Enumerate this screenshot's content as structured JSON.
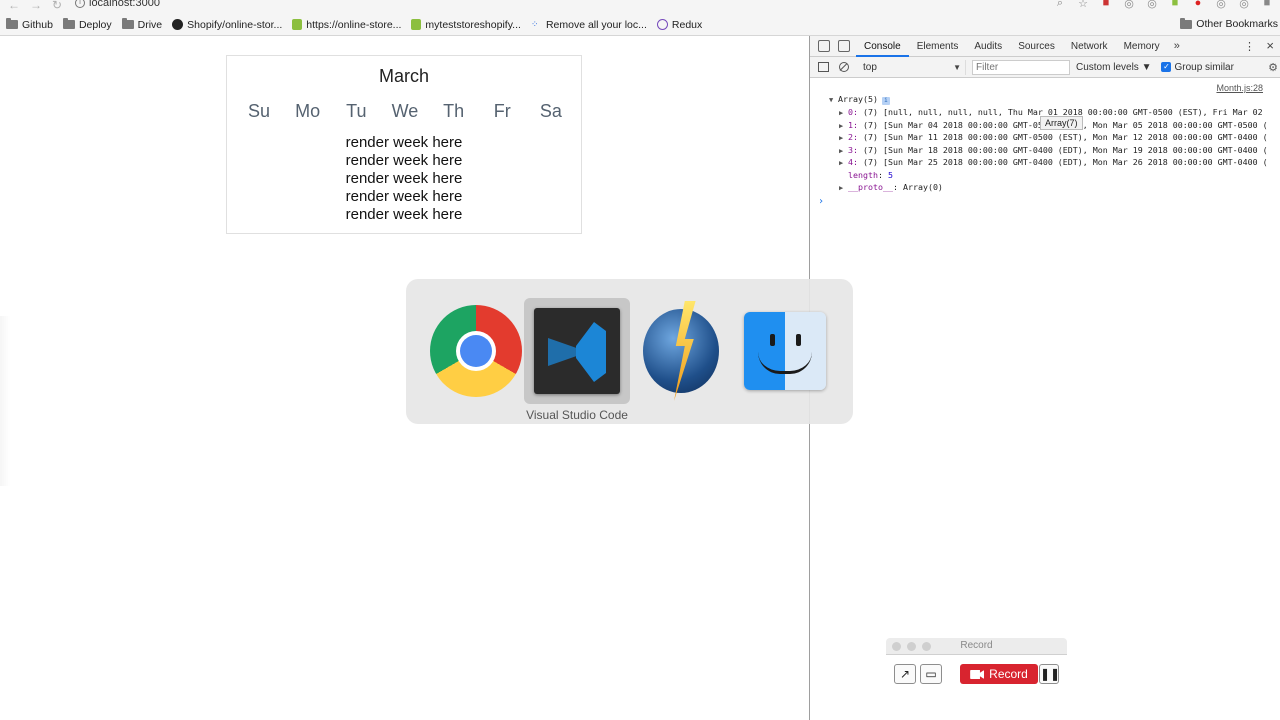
{
  "browser": {
    "url": "localhost:3000",
    "bookmarks": [
      {
        "label": "Github",
        "icon": "folder-icon"
      },
      {
        "label": "Deploy",
        "icon": "folder-icon"
      },
      {
        "label": "Drive",
        "icon": "folder-icon"
      },
      {
        "label": "Shopify/online-stor...",
        "icon": "github-icon"
      },
      {
        "label": "https://online-store...",
        "icon": "shopify-icon"
      },
      {
        "label": "myteststoreshopify...",
        "icon": "shopify-icon"
      },
      {
        "label": "Remove all your loc...",
        "icon": "dots-icon"
      },
      {
        "label": "Redux",
        "icon": "redux-icon"
      }
    ],
    "other_bookmarks": "Other Bookmarks"
  },
  "calendar": {
    "month": "March",
    "days": [
      "Su",
      "Mo",
      "Tu",
      "We",
      "Th",
      "Fr",
      "Sa"
    ],
    "weeks": [
      "render week here",
      "render week here",
      "render week here",
      "render week here",
      "render week here"
    ]
  },
  "app_switcher": {
    "apps": [
      {
        "name": "Google Chrome",
        "icon": "chrome-icon"
      },
      {
        "name": "Visual Studio Code",
        "icon": "vscode-icon",
        "selected": true
      },
      {
        "name": "Reeder",
        "icon": "lightning-globe-icon"
      },
      {
        "name": "Finder",
        "icon": "finder-icon"
      }
    ],
    "selected_label": "Visual Studio Code"
  },
  "devtools": {
    "tabs": [
      "Console",
      "Elements",
      "Audits",
      "Sources",
      "Network",
      "Memory"
    ],
    "active_tab": "Console",
    "more": "»",
    "context": "top",
    "filter_placeholder": "Filter",
    "levels": "Custom levels ▼",
    "group_similar": "Group similar",
    "source_link": "Month.js:28",
    "log_head": "Array(5)",
    "rows": [
      {
        "idx": "0:",
        "text": "(7) [null, null, null, null, Thu Mar 01 2018 00:00:00 GMT-0500 (EST), Fri Mar 02"
      },
      {
        "idx": "1:",
        "text": "(7) [Sun Mar 04 2018 00:00:00 GMT-0500 (EST), Mon Mar 05 2018 00:00:00 GMT-0500 ("
      },
      {
        "idx": "2:",
        "text": "(7) [Sun Mar 11 2018 00:00:00 GMT-0500 (EST), Mon Mar 12 2018 00:00:00 GMT-0400 ("
      },
      {
        "idx": "3:",
        "text": "(7) [Sun Mar 18 2018 00:00:00 GMT-0400 (EDT), Mon Mar 19 2018 00:00:00 GMT-0400 ("
      },
      {
        "idx": "4:",
        "text": "(7) [Sun Mar 25 2018 00:00:00 GMT-0400 (EDT), Mon Mar 26 2018 00:00:00 GMT-0400 ("
      }
    ],
    "length_key": "length",
    "length_val": "5",
    "proto_key": "__proto__",
    "proto_val": "Array(0)",
    "tooltip": "Array(7)",
    "prompt": "›"
  },
  "recorder": {
    "title": "Record",
    "record_label": "Record"
  }
}
